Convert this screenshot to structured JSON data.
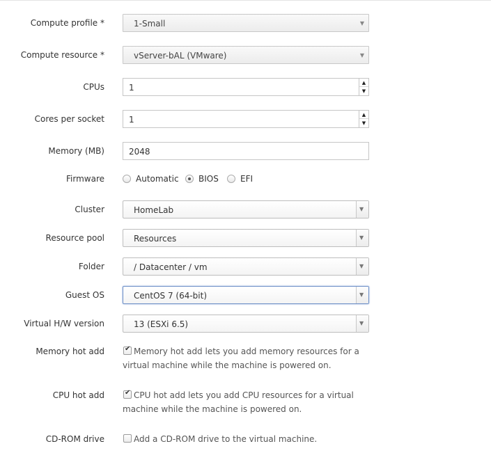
{
  "compute_profile": {
    "label": "Compute profile *",
    "value": "1-Small"
  },
  "compute_resource": {
    "label": "Compute resource *",
    "value": "vServer-bAL (VMware)"
  },
  "cpus": {
    "label": "CPUs",
    "value": "1"
  },
  "cores_per_socket": {
    "label": "Cores per socket",
    "value": "1"
  },
  "memory": {
    "label": "Memory (MB)",
    "value": "2048"
  },
  "firmware": {
    "label": "Firmware",
    "options": [
      "Automatic",
      "BIOS",
      "EFI"
    ],
    "selected": "BIOS"
  },
  "cluster": {
    "label": "Cluster",
    "value": "HomeLab"
  },
  "resource_pool": {
    "label": "Resource pool",
    "value": "Resources"
  },
  "folder": {
    "label": "Folder",
    "value": "/ Datacenter / vm"
  },
  "guest_os": {
    "label": "Guest OS",
    "value": "CentOS 7 (64-bit)"
  },
  "hw_version": {
    "label": "Virtual H/W version",
    "value": "13 (ESXi 6.5)"
  },
  "memory_hot_add": {
    "label": "Memory hot add",
    "checked": true,
    "text": "Memory hot add lets you add memory resources for a virtual machine while the machine is powered on."
  },
  "cpu_hot_add": {
    "label": "CPU hot add",
    "checked": true,
    "text": "CPU hot add lets you add CPU resources for a virtual machine while the machine is powered on."
  },
  "cdrom": {
    "label": "CD-ROM drive",
    "checked": false,
    "text": "Add a CD-ROM drive to the virtual machine."
  }
}
